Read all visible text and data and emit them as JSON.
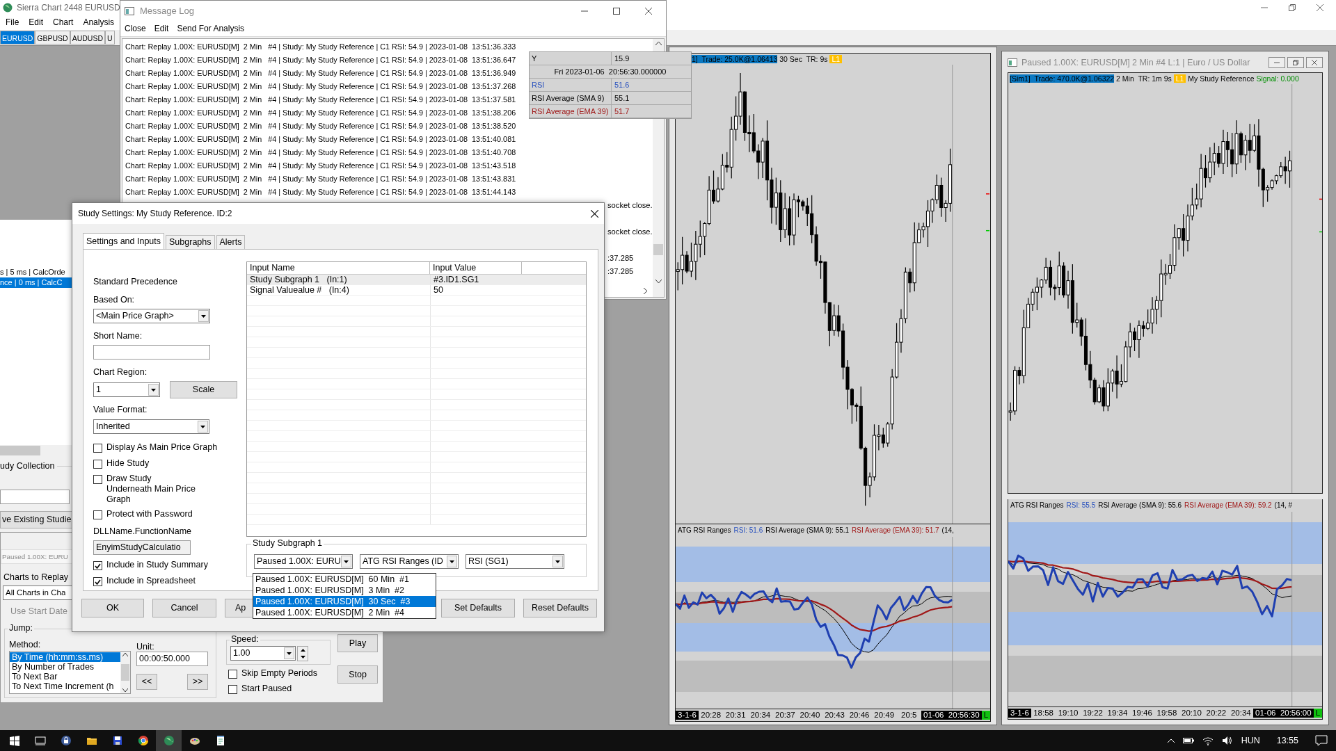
{
  "main_window": {
    "title": "Sierra Chart 2448 EURUSD",
    "menu": [
      "File",
      "Edit",
      "Chart",
      "Analysis"
    ],
    "symbol_tabs": [
      {
        "label": "EURUSD",
        "selected": true
      },
      {
        "label": "GBPUSD",
        "selected": false
      },
      {
        "label": "AUDUSD",
        "selected": false
      },
      {
        "label": "U",
        "selected": false
      }
    ]
  },
  "message_log": {
    "title": "Message Log",
    "menu": [
      "Close",
      "Edit",
      "Send For Analysis"
    ],
    "lines": [
      "Chart: Replay 1.00X: EURUSD[M]  2 Min   #4 | Study: My Study Reference | C1 RSI: 54.9 | 2023-01-08  13:51:36.333",
      "Chart: Replay 1.00X: EURUSD[M]  2 Min   #4 | Study: My Study Reference | C1 RSI: 54.9 | 2023-01-08  13:51:36.647",
      "Chart: Replay 1.00X: EURUSD[M]  2 Min   #4 | Study: My Study Reference | C1 RSI: 54.9 | 2023-01-08  13:51:36.949",
      "Chart: Replay 1.00X: EURUSD[M]  2 Min   #4 | Study: My Study Reference | C1 RSI: 54.9 | 2023-01-08  13:51:37.268",
      "Chart: Replay 1.00X: EURUSD[M]  2 Min   #4 | Study: My Study Reference | C1 RSI: 54.9 | 2023-01-08  13:51:37.581",
      "Chart: Replay 1.00X: EURUSD[M]  2 Min   #4 | Study: My Study Reference | C1 RSI: 54.9 | 2023-01-08  13:51:38.206",
      "Chart: Replay 1.00X: EURUSD[M]  2 Min   #4 | Study: My Study Reference | C1 RSI: 54.9 | 2023-01-08  13:51:38.520",
      "Chart: Replay 1.00X: EURUSD[M]  2 Min   #4 | Study: My Study Reference | C1 RSI: 54.9 | 2023-01-08  13:51:40.081",
      "Chart: Replay 1.00X: EURUSD[M]  2 Min   #4 | Study: My Study Reference | C1 RSI: 54.9 | 2023-01-08  13:51:40.708",
      "Chart: Replay 1.00X: EURUSD[M]  2 Min   #4 | Study: My Study Reference | C1 RSI: 54.9 | 2023-01-08  13:51:43.518",
      "Chart: Replay 1.00X: EURUSD[M]  2 Min   #4 | Study: My Study Reference | C1 RSI: 54.9 | 2023-01-08  13:51:43.831",
      "Chart: Replay 1.00X: EURUSD[M]  2 Min   #4 | Study: My Study Reference | C1 RSI: 54.9 | 2023-01-08  13:51:44.143"
    ],
    "fragments": [
      "socket close.",
      "socket close.",
      ":37.285",
      ":37.285"
    ]
  },
  "tooltip": {
    "label": "Y",
    "value": "15.9",
    "time": "Fri 2023-01-06  20:56:30.000000",
    "rows": [
      {
        "label": "RSI",
        "value": "51.6",
        "color": "#2a52be"
      },
      {
        "label": "RSI Average (SMA 9)",
        "value": "55.1",
        "color": "#000000"
      },
      {
        "label": "RSI Average (EMA 39)",
        "value": "51.7",
        "color": "#a01818"
      }
    ]
  },
  "studies_panel": {
    "log_rows": [
      {
        "text": "s | 5 ms | CalcOrde",
        "selected": false
      },
      {
        "text": "nce | 0 ms | CalcC",
        "selected": true
      }
    ],
    "collection_label": "udy Collection",
    "save_button": "ve Existing Studie"
  },
  "replay_panel": {
    "chart": "Paused 1.00X: EURU",
    "charts_label": "Charts to Replay",
    "charts_value": "All Charts in Cha",
    "start_date": "Use Start Date",
    "jump_label": "Jump:",
    "method_label": "Method:",
    "methods": [
      {
        "label": "By Time (hh:mm:ss.ms)",
        "selected": true
      },
      {
        "label": "By Number of Trades",
        "selected": false
      },
      {
        "label": "To Next Bar",
        "selected": false
      },
      {
        "label": "To Next Time Increment (h",
        "selected": false
      }
    ],
    "unit_label": "Unit:",
    "unit_value": "00:00:50.000",
    "back": "<<",
    "forward": ">>",
    "speed_label": "Speed:",
    "speed_value": "1.00",
    "options": [
      {
        "label": "Skip Empty Periods",
        "checked": false
      },
      {
        "label": "Start Paused",
        "checked": false
      }
    ],
    "play": "Play",
    "stop": "Stop"
  },
  "study_settings": {
    "title": "Study Settings: My Study Reference. ID:2",
    "tabs": [
      {
        "label": "Settings and Inputs",
        "selected": true
      },
      {
        "label": "Subgraphs",
        "selected": false
      },
      {
        "label": "Alerts",
        "selected": false
      }
    ],
    "precedence": "Standard Precedence",
    "based_on_label": "Based On:",
    "based_on": "<Main Price Graph>",
    "short_name_label": "Short Name:",
    "chart_region_label": "Chart Region:",
    "chart_region": "1",
    "scale_button": "Scale",
    "value_format_label": "Value Format:",
    "value_format": "Inherited",
    "options": [
      {
        "label": "Display As Main Price Graph",
        "checked": false
      },
      {
        "label": "Hide Study",
        "checked": false
      },
      {
        "label": "Draw Study Underneath Main Price Graph",
        "checked": false
      },
      {
        "label": "Protect with Password",
        "checked": false
      }
    ],
    "dll_label": "DLLName.FunctionName",
    "dll_value": "EnyimStudyCalculatio",
    "summary_options": [
      {
        "label": "Include in Study Summary",
        "checked": true
      },
      {
        "label": "Include in Spreadsheet",
        "checked": true
      }
    ],
    "inputs": {
      "columns": [
        "Input Name",
        "Input Value"
      ],
      "rows": [
        {
          "name": "Study Subgraph 1   (In:1)",
          "value": "#3.ID1.SG1",
          "selected": true
        },
        {
          "name": "Signal Valuealue #   (In:4)",
          "value": "50",
          "selected": false
        }
      ]
    },
    "subgraph_group": {
      "label": "Study Subgraph 1",
      "chart_select": "Paused 1.00X: EURU",
      "study_select": "ATG RSI Ranges (ID",
      "subgraph_select": "RSI (SG1)",
      "chart_options": [
        {
          "label": "Paused 1.00X: EURUSD[M]  60 Min  #1",
          "selected": false
        },
        {
          "label": "Paused 1.00X: EURUSD[M]  3 Min  #2",
          "selected": false
        },
        {
          "label": "Paused 1.00X: EURUSD[M]  30 Sec  #3",
          "selected": true
        },
        {
          "label": "Paused 1.00X: EURUSD[M]  2 Min  #4",
          "selected": false
        }
      ]
    },
    "buttons": [
      "OK",
      "Cancel",
      "Ap",
      "Set Defaults",
      "Reset Defaults"
    ]
  },
  "charts": [
    {
      "header": {
        "trade": "1]  Trade: 25.0K@1.06413",
        "interval": "30 Sec  TR: 9s",
        "badge": "L1"
      },
      "rsi_legend": [
        {
          "text": "ATG RSI Ranges",
          "color": "#000000"
        },
        {
          "text": "RSI: 51.6",
          "color": "#2a52be"
        },
        {
          "text": "RSI Average (SMA 9): 55.1",
          "color": "#000000"
        },
        {
          "text": "RSI Average (EMA 39): 51.7",
          "color": "#a01818"
        },
        {
          "text": "(14,",
          "color": "#000000"
        }
      ],
      "start_date": "3-1-6",
      "time_axis": [
        "20:28",
        "20:31",
        "20:34",
        "20:37",
        "20:40",
        "20:43",
        "20:46",
        "20:49",
        "20:5"
      ],
      "cursor_time": "01-06  20:56:30",
      "status": "L"
    },
    {
      "title": "Paused 1.00X: EURUSD[M]  2 Min   #4 L:1 | Euro / US Dollar",
      "header": {
        "trade": "[Sim1]  Trade: 470.0K@1.06322",
        "interval": "2 Min  TR: 1m 9s",
        "badge": "L1",
        "study": "My Study Reference",
        "signal": "Signal: 0.000"
      },
      "rsi_legend": [
        {
          "text": "ATG RSI Ranges",
          "color": "#000000"
        },
        {
          "text": "RSI: 55.5",
          "color": "#2a52be"
        },
        {
          "text": "RSI Average (SMA 9): 55.6",
          "color": "#000000"
        },
        {
          "text": "RSI Average (EMA 39): 59.2",
          "color": "#a01818"
        },
        {
          "text": "(14, #",
          "color": "#000000"
        }
      ],
      "start_date": "3-1-6",
      "time_axis": [
        "18:58",
        "19:10",
        "19:22",
        "19:34",
        "19:46",
        "19:58",
        "20:10",
        "20:22",
        "20:34"
      ],
      "cursor_time": "01-06  20:56:00",
      "status": "L"
    }
  ],
  "taskbar": {
    "language": "HUN",
    "time": "13:55"
  }
}
